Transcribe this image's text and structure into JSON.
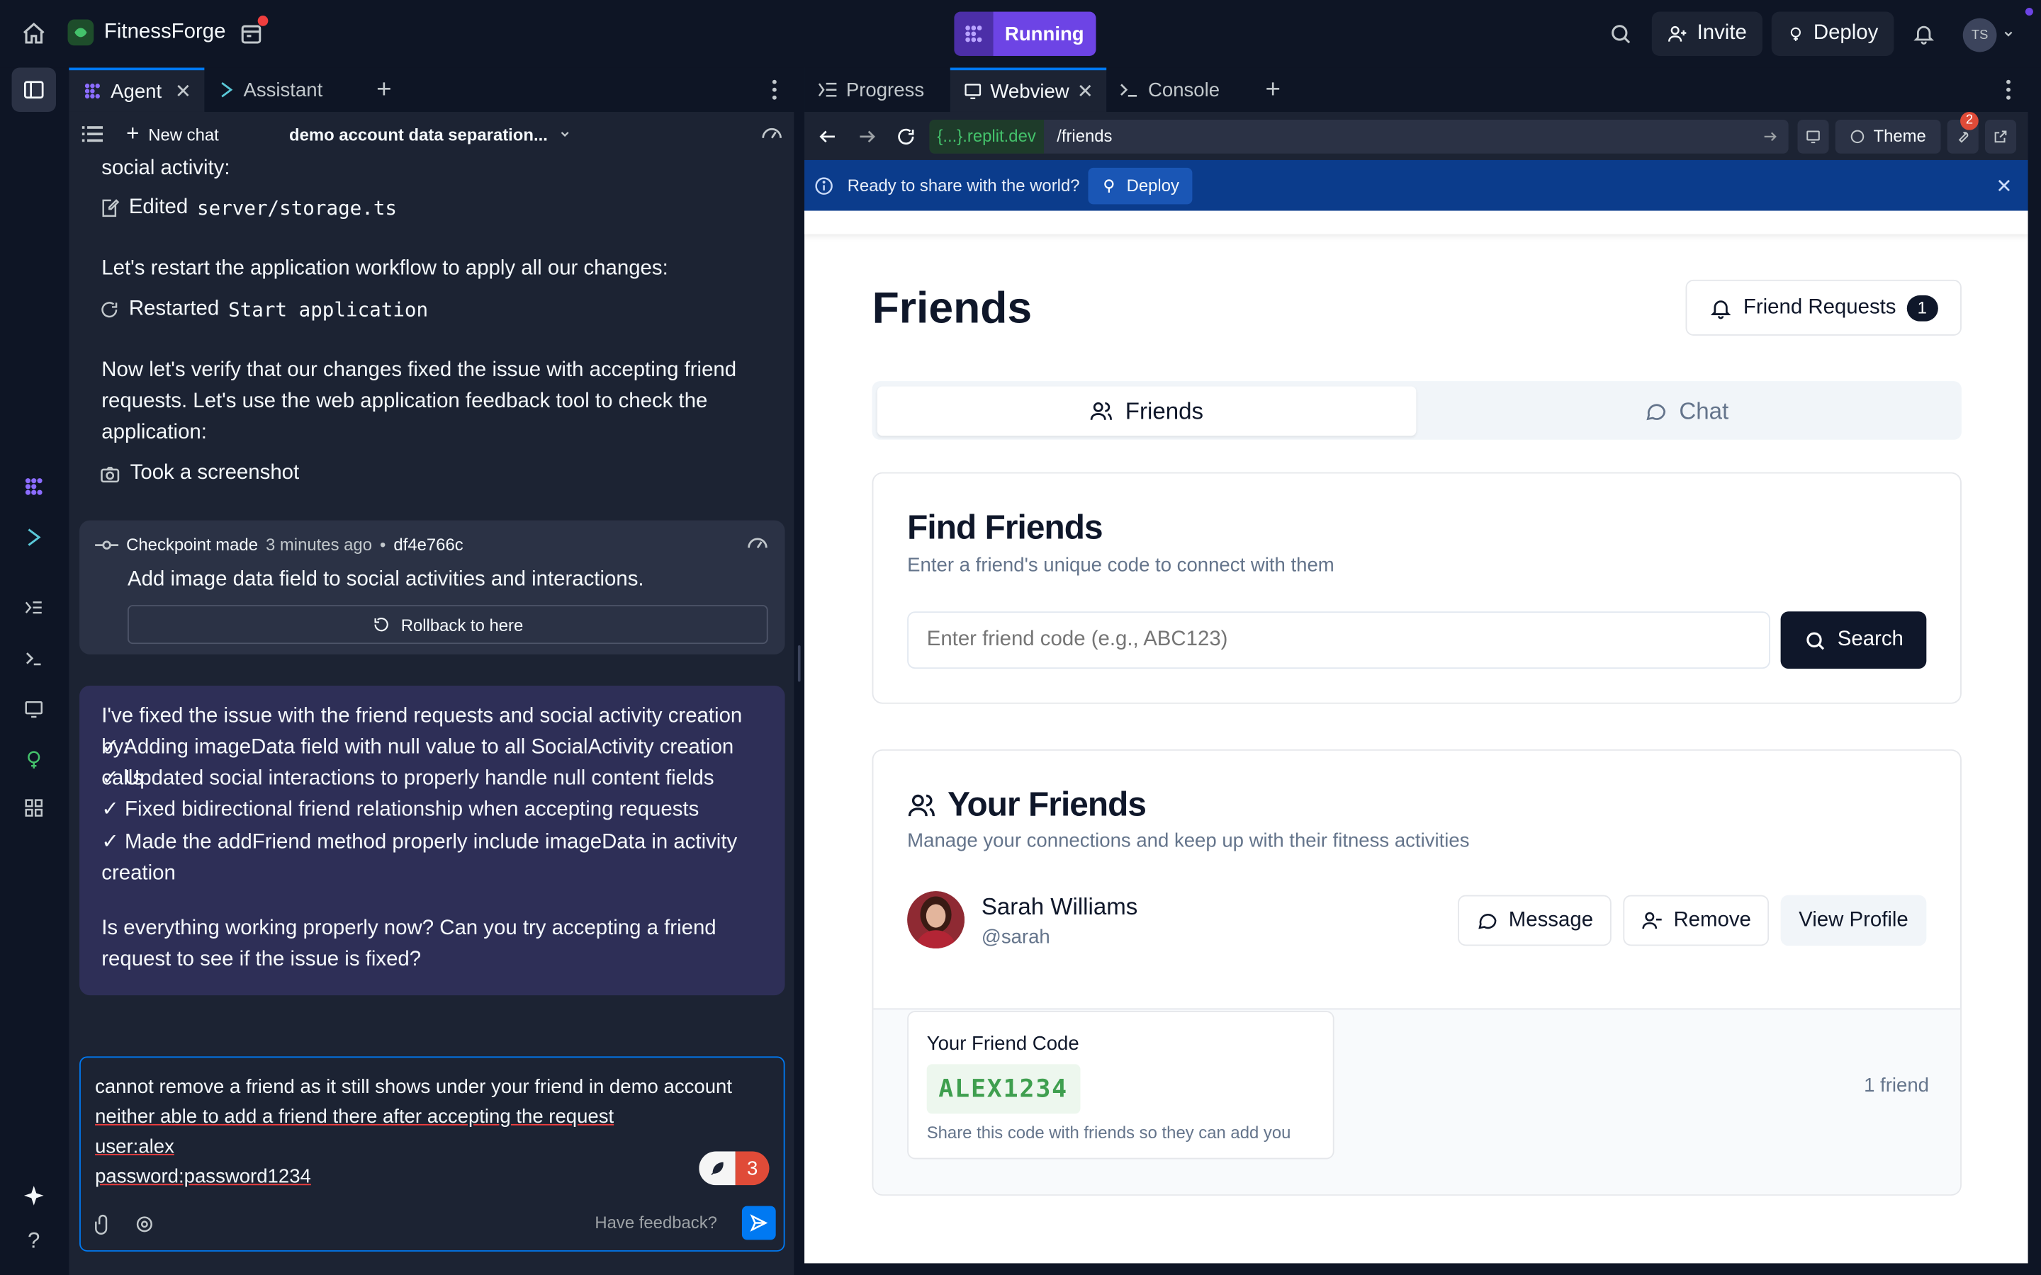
{
  "topbar": {
    "app_name": "FitnessForge",
    "run_status": "Running",
    "invite_label": "Invite",
    "deploy_label": "Deploy",
    "avatar_initials": "TS"
  },
  "left_panel": {
    "tabs": [
      {
        "label": "Agent"
      },
      {
        "label": "Assistant"
      }
    ],
    "new_chat_label": "New chat",
    "chat_title": "demo account data separation...",
    "messages": {
      "line_social": "social activity:",
      "edited_label": "Edited",
      "edited_file": "server/storage.ts",
      "restart_text": "Let's restart the application workflow to apply all our changes:",
      "restarted_label": "Restarted",
      "restarted_target": "Start application",
      "verify_text": "Now let's verify that our changes fixed the issue with accepting friend requests. Let's use the web application feedback tool to check the application:",
      "screenshot_label": "Took a screenshot"
    },
    "checkpoint": {
      "label": "Checkpoint made",
      "time": "3 minutes ago",
      "sep": "•",
      "hash": "df4e766c",
      "description": "Add image data field to social activities and interactions.",
      "rollback_label": "Rollback to here"
    },
    "summary": {
      "intro": "I've fixed the issue with the friend requests and social activity creation by:",
      "items": [
        "✓ Adding imageData field with null value to all SocialActivity creation calls",
        "✓ Updated social interactions to properly handle null content fields",
        "✓ Fixed bidirectional friend relationship when accepting requests",
        "✓ Made the addFriend method properly include imageData in activity creation"
      ],
      "question": "Is everything working properly now? Can you try accepting a friend request to see if the issue is fixed?"
    },
    "input": {
      "line1": "cannot remove a friend as it still shows under your friend in demo account",
      "line2": "neither able to add a friend there after accepting the request",
      "line3": "user:alex",
      "line4": "password:password1234",
      "spell_count": "3",
      "feedback_label": "Have feedback?"
    }
  },
  "right_panel": {
    "tabs": [
      {
        "label": "Progress"
      },
      {
        "label": "Webview"
      },
      {
        "label": "Console"
      }
    ],
    "url_domain": "{...}.replit.dev",
    "url_path": "/friends",
    "theme_label": "Theme",
    "notif_count": "2",
    "banner_text": "Ready to share with the world?",
    "banner_deploy": "Deploy"
  },
  "webview": {
    "page_title": "Friends",
    "friend_requests_label": "Friend Requests",
    "friend_requests_count": "1",
    "tabs": [
      {
        "label": "Friends"
      },
      {
        "label": "Chat"
      }
    ],
    "find": {
      "title": "Find Friends",
      "subtitle": "Enter a friend's unique code to connect with them",
      "placeholder": "Enter friend code (e.g., ABC123)",
      "search_label": "Search"
    },
    "your_friends": {
      "title": "Your Friends",
      "subtitle": "Manage your connections and keep up with their fitness activities",
      "friend_name": "Sarah Williams",
      "friend_handle": "@sarah",
      "message_label": "Message",
      "remove_label": "Remove",
      "view_profile_label": "View Profile",
      "code_title": "Your Friend Code",
      "code_value": "ALEX1234",
      "code_hint": "Share this code with friends so they can add you",
      "friend_count": "1 friend"
    }
  }
}
